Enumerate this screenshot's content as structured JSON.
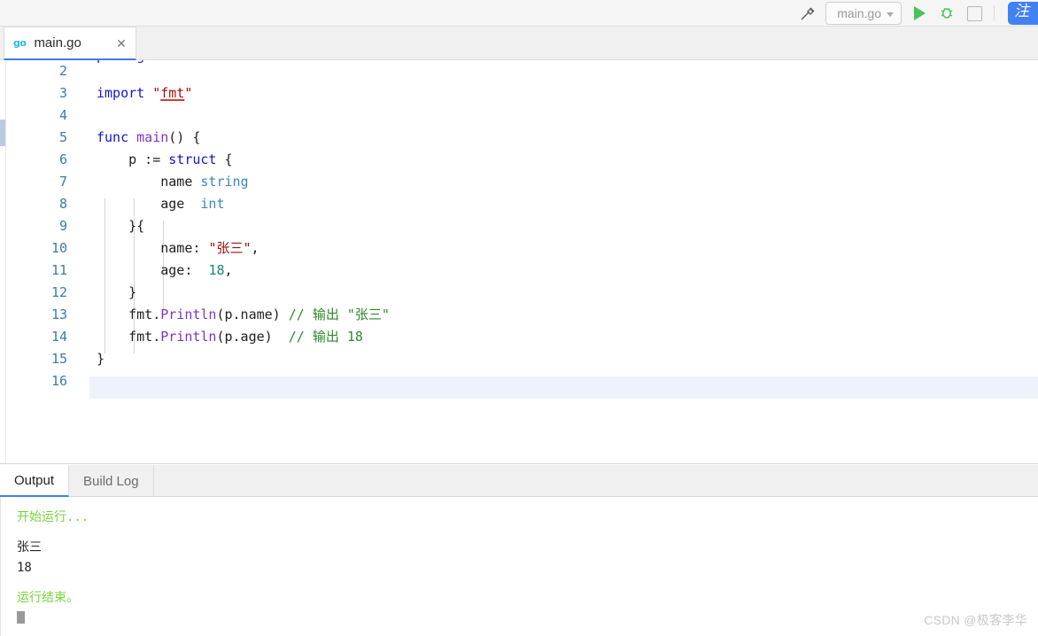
{
  "toolbar": {
    "build_icon": "hammer-icon",
    "run_config_label": "main.go",
    "run_icon": "run-triangle-icon",
    "debug_icon": "debug-bug-icon",
    "stop_icon": "stop-square-icon",
    "blue_button_glyph": "注"
  },
  "tabs": {
    "file_icon": "go",
    "file_label": "main.go",
    "close_glyph": "✕"
  },
  "editor": {
    "clipped_first_line": "package main",
    "lines": [
      {
        "num": "2",
        "tokens": []
      },
      {
        "num": "3",
        "tokens": [
          {
            "t": "import",
            "c": "kw"
          },
          {
            "t": " ",
            "c": "pln"
          },
          {
            "t": "\"",
            "c": "str"
          },
          {
            "t": "fmt",
            "c": "str err"
          },
          {
            "t": "\"",
            "c": "str"
          }
        ]
      },
      {
        "num": "4",
        "tokens": []
      },
      {
        "num": "5",
        "tokens": [
          {
            "t": "func",
            "c": "kw"
          },
          {
            "t": " ",
            "c": "pln"
          },
          {
            "t": "main",
            "c": "fn"
          },
          {
            "t": "() {",
            "c": "pln"
          }
        ]
      },
      {
        "num": "6",
        "tokens": [
          {
            "t": "    p := ",
            "c": "pln"
          },
          {
            "t": "struct",
            "c": "kw"
          },
          {
            "t": " {",
            "c": "pln"
          }
        ]
      },
      {
        "num": "7",
        "tokens": [
          {
            "t": "        name ",
            "c": "pln"
          },
          {
            "t": "string",
            "c": "typ"
          }
        ]
      },
      {
        "num": "8",
        "tokens": [
          {
            "t": "        age  ",
            "c": "pln"
          },
          {
            "t": "int",
            "c": "typ"
          }
        ]
      },
      {
        "num": "9",
        "tokens": [
          {
            "t": "    }{",
            "c": "pln"
          }
        ]
      },
      {
        "num": "10",
        "tokens": [
          {
            "t": "        name: ",
            "c": "pln"
          },
          {
            "t": "\"张三\"",
            "c": "str"
          },
          {
            "t": ",",
            "c": "pln"
          }
        ]
      },
      {
        "num": "11",
        "tokens": [
          {
            "t": "        age:  ",
            "c": "pln"
          },
          {
            "t": "18",
            "c": "num"
          },
          {
            "t": ",",
            "c": "pln"
          }
        ]
      },
      {
        "num": "12",
        "tokens": [
          {
            "t": "    }",
            "c": "pln"
          }
        ]
      },
      {
        "num": "13",
        "tokens": [
          {
            "t": "    fmt.",
            "c": "pln"
          },
          {
            "t": "Println",
            "c": "fn"
          },
          {
            "t": "(p.name) ",
            "c": "pln"
          },
          {
            "t": "// 输出 \"张三\"",
            "c": "cmt"
          }
        ]
      },
      {
        "num": "14",
        "tokens": [
          {
            "t": "    fmt.",
            "c": "pln"
          },
          {
            "t": "Println",
            "c": "fn"
          },
          {
            "t": "(p.age)  ",
            "c": "pln"
          },
          {
            "t": "// 输出 18",
            "c": "cmt"
          }
        ]
      },
      {
        "num": "15",
        "tokens": [
          {
            "t": "}",
            "c": "pln"
          }
        ]
      },
      {
        "num": "16",
        "tokens": []
      }
    ],
    "current_line": "16"
  },
  "panel": {
    "tabs": [
      {
        "label": "Output",
        "active": true
      },
      {
        "label": "Build Log",
        "active": false
      }
    ],
    "console": [
      {
        "text": "开始运行...",
        "style": "ok"
      },
      {
        "text": "",
        "style": "blank"
      },
      {
        "text": "张三",
        "style": "outtext"
      },
      {
        "text": "18",
        "style": "outtext"
      },
      {
        "text": "",
        "style": "blank"
      },
      {
        "text": "运行结束。",
        "style": "ok"
      }
    ]
  },
  "watermark": "CSDN @极客李华",
  "colors": {
    "accent_blue": "#3f7ee8",
    "run_green": "#49c357",
    "console_green": "#76d63a",
    "keyword": "#1414cc",
    "string": "#9c1111",
    "comment": "#2d8a2d",
    "type": "#3a87c2",
    "number": "#12896b",
    "function": "#7b36c4",
    "line_number": "#3b7ca8",
    "current_line_bg": "#eef2fb"
  }
}
